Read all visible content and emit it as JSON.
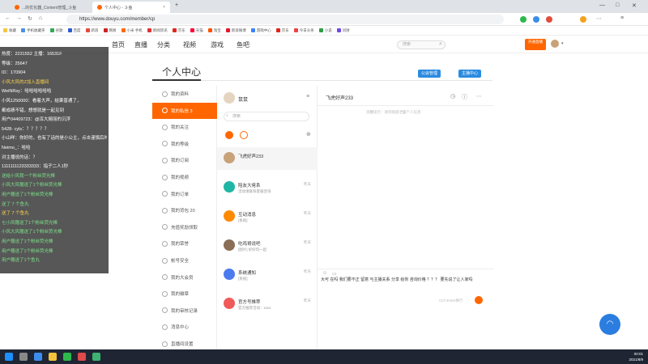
{
  "browser": {
    "tabs": [
      {
        "label": "...的优化器_Content管理_斗鱼"
      },
      {
        "label": "个人中心 - 斗鱼"
      }
    ],
    "url": "https://www.douyu.com/member/cp",
    "bookmarks": [
      "收藏",
      "手机收藏夹",
      "谷歌",
      "百度",
      "新浪",
      "网易",
      "小米 手机",
      "新闻资讯",
      "京东",
      "天猫",
      "淘宝",
      "新浪微博",
      "游戏中心",
      "京东",
      "今日头条",
      "小说",
      "问财"
    ]
  },
  "site": {
    "nav": [
      "首页",
      "直播",
      "分类",
      "视频",
      "游戏",
      "鱼吧"
    ],
    "search_placeholder": "搜索",
    "open_live_label": "开通直播"
  },
  "danmaku": {
    "lines": [
      {
        "text": "热度：2231552   主播：16531F",
        "color": "white"
      },
      {
        "text": "等级：25647",
        "color": "white"
      },
      {
        "text": "ID：170904",
        "color": "white"
      },
      {
        "text": "小风大风的Z加入直播间",
        "color": "yellow"
      },
      {
        "text": "WeiNRsy：哈哈哈哈哈哈",
        "color": "white"
      },
      {
        "text": "小风1250000：看着大声，结果普通了，",
        "color": "white"
      },
      {
        "text": "都成绩不错，想想就是一起见到",
        "color": "white"
      },
      {
        "text": "用户04409723：@浑大婉丽的沉浮",
        "color": "white"
      },
      {
        "text": "5428- cyls：？？？？？",
        "color": "white"
      },
      {
        "text": "小山咩：你好的，也有了话的是小公主，点击谨慎后时刻",
        "color": "white"
      },
      {
        "text": "Neimo_：哈哈",
        "color": "white"
      },
      {
        "text": "对主播说的话：？",
        "color": "white"
      },
      {
        "text": "1111111123333333：指子二人1秒",
        "color": "white"
      },
      {
        "text": "送给小风我一个粉丝荧光棒",
        "color": "green"
      },
      {
        "text": "小风大风赠送了1个粉丝荧光棒",
        "color": "green"
      },
      {
        "text": "用户赠送了1个粉丝荧光棒",
        "color": "green"
      },
      {
        "text": "送了 7 个鱼丸",
        "color": "green"
      },
      {
        "text": "送了 7 个鱼丸",
        "color": "yellow"
      },
      {
        "text": "七小风赠送了1个粉丝荧光棒",
        "color": "green"
      },
      {
        "text": "小风大风赠送了1个粉丝荧光棒",
        "color": "green"
      },
      {
        "text": "用户赠送了1个粉丝荧光棒",
        "color": "green"
      },
      {
        "text": "用户赠送了1个粉丝荧光棒",
        "color": "green"
      },
      {
        "text": "用户赠送了1个鱼丸",
        "color": "green"
      }
    ]
  },
  "page": {
    "title": "个人中心",
    "top_buttons": [
      "公会管理",
      "主播中心"
    ]
  },
  "sidebar": {
    "items": [
      {
        "label": "我的资料",
        "active": false
      },
      {
        "label": "我的私信 3",
        "active": true
      },
      {
        "label": "我的关注",
        "active": false
      },
      {
        "label": "我的等级",
        "active": false
      },
      {
        "label": "我的订阅",
        "active": false
      },
      {
        "label": "我的视频",
        "active": false
      },
      {
        "label": "我的订单",
        "active": false
      },
      {
        "label": "我的背包 20",
        "active": false
      },
      {
        "label": "充值奖励领取",
        "active": false
      },
      {
        "label": "我的荣誉",
        "active": false
      },
      {
        "label": "帐号安全",
        "active": false
      },
      {
        "label": "我的大会员",
        "active": false
      },
      {
        "label": "我的徽章",
        "active": false
      },
      {
        "label": "我的审核记录",
        "active": false
      },
      {
        "label": "消息中心",
        "active": false
      },
      {
        "label": "直播间设置",
        "active": false
      }
    ]
  },
  "conversations": {
    "user_name": "鼠鼠",
    "search_placeholder": "搜索",
    "list": [
      {
        "name": "飞虎好声233",
        "preview": "",
        "time": ""
      },
      {
        "name": "陪友大佬系",
        "preview": "活动请联系客服咨询",
        "time": "昨天"
      },
      {
        "name": "互动消息",
        "preview": "[系统]",
        "time": "昨天"
      },
      {
        "name": "吃鸡哥说吧",
        "preview": "[图片] 好好玩一起",
        "time": "昨天"
      },
      {
        "name": "系统通知",
        "preview": "[系统]",
        "time": "昨天"
      },
      {
        "name": "官方号推荐",
        "preview": "官方推荐活动：xxxx",
        "time": "昨天"
      }
    ]
  },
  "chat": {
    "title": "飞虎好声233",
    "system_hint": "温馨提示：请勿随意泄露个人信息",
    "input_text": "大可 在吗  我们要不正 留意 与主播关系 分享 给你 咨询价格 ？？？ 要先说了让人家吗",
    "send_hint": "Ctrl+Enter换行"
  },
  "taskbar": {
    "time": "00:01",
    "date": "2021/8/9"
  }
}
